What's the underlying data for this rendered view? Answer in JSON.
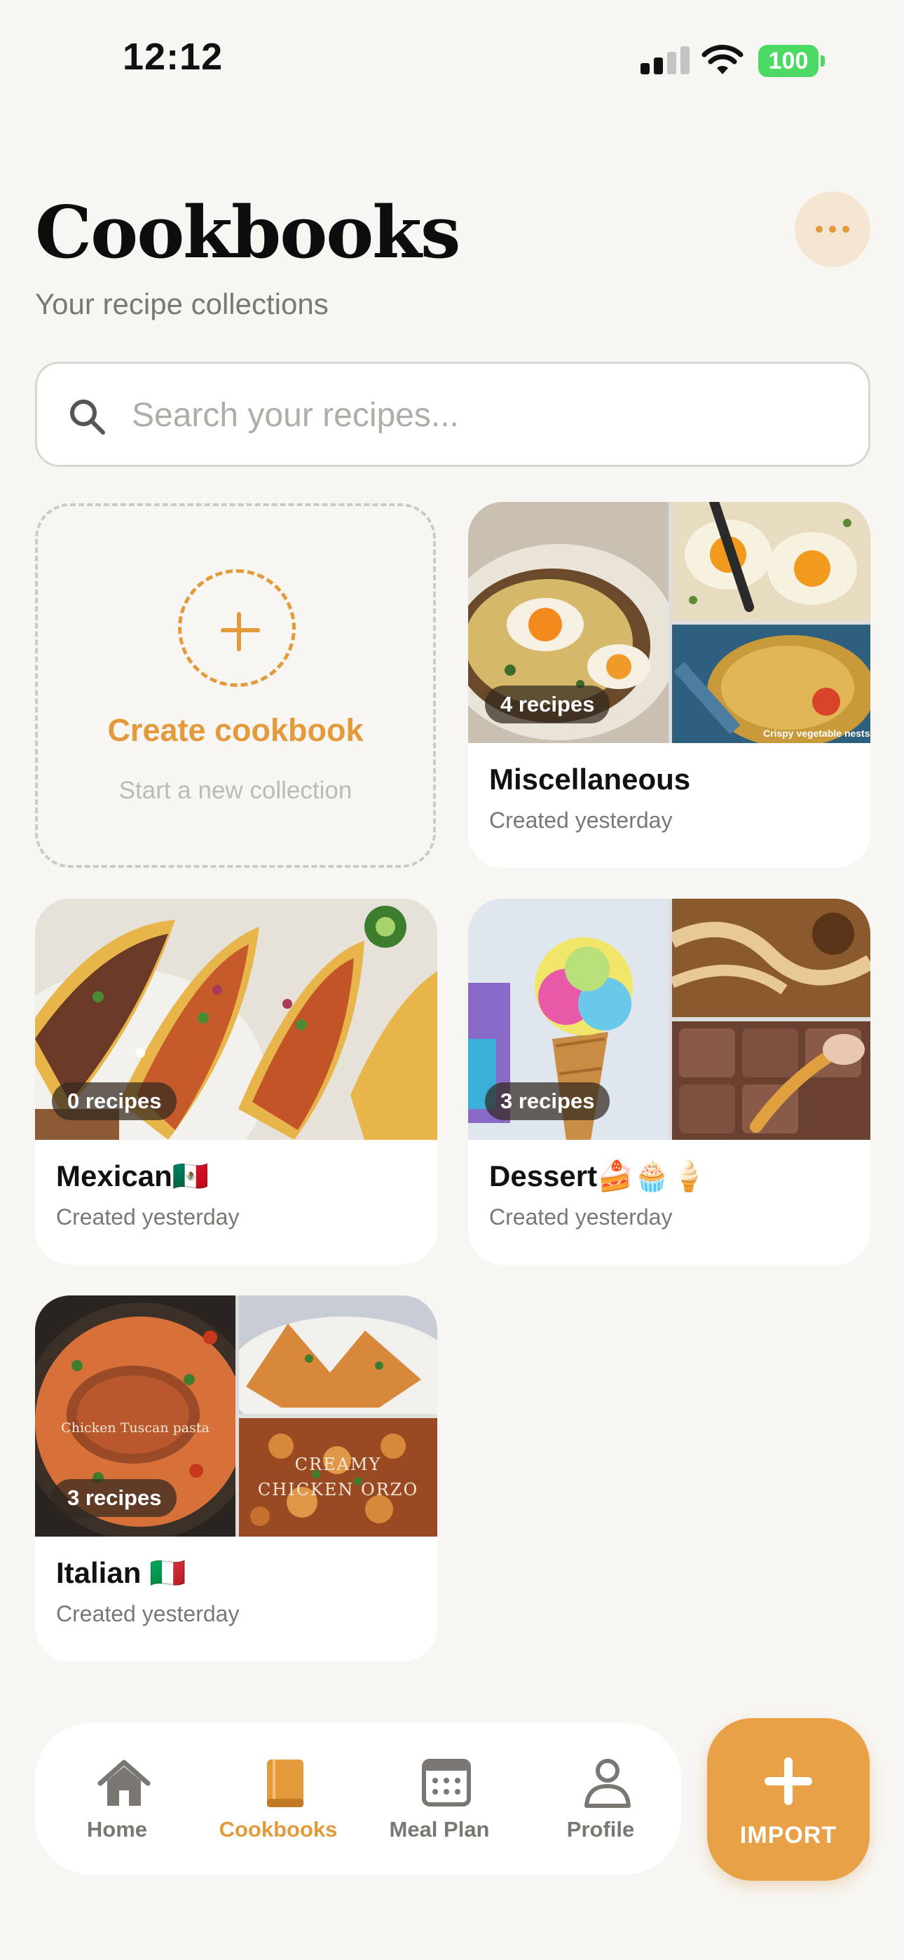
{
  "status_bar": {
    "time": "12:12",
    "battery": "100"
  },
  "header": {
    "title": "Cookbooks",
    "subtitle": "Your recipe collections"
  },
  "search": {
    "placeholder": "Search your recipes..."
  },
  "create_card": {
    "title": "Create cookbook",
    "subtitle": "Start a new collection"
  },
  "cookbooks": [
    {
      "title": "Miscellaneous",
      "recipes": "4 recipes",
      "created": "Created yesterday",
      "image_caption": "Crispy vegetable nests"
    },
    {
      "title": "Mexican🇲🇽",
      "recipes": "0 recipes",
      "created": "Created yesterday"
    },
    {
      "title": "Dessert🍰🧁🍦",
      "recipes": "3 recipes",
      "created": "Created yesterday"
    },
    {
      "title": "Italian 🇮🇹",
      "recipes": "3 recipes",
      "created": "Created yesterday",
      "image_caption_1": "Chicken Tuscan pasta",
      "image_caption_2": "Creamy chicken Orzo"
    }
  ],
  "nav": {
    "items": [
      {
        "label": "Home",
        "icon": "home-icon"
      },
      {
        "label": "Cookbooks",
        "icon": "book-icon",
        "active": true
      },
      {
        "label": "Meal Plan",
        "icon": "calendar-icon"
      },
      {
        "label": "Profile",
        "icon": "person-icon"
      }
    ],
    "import_label": "IMPORT"
  },
  "colors": {
    "accent": "#e29a3b",
    "background": "#f8f6f3",
    "muted_text": "#7b7873"
  }
}
